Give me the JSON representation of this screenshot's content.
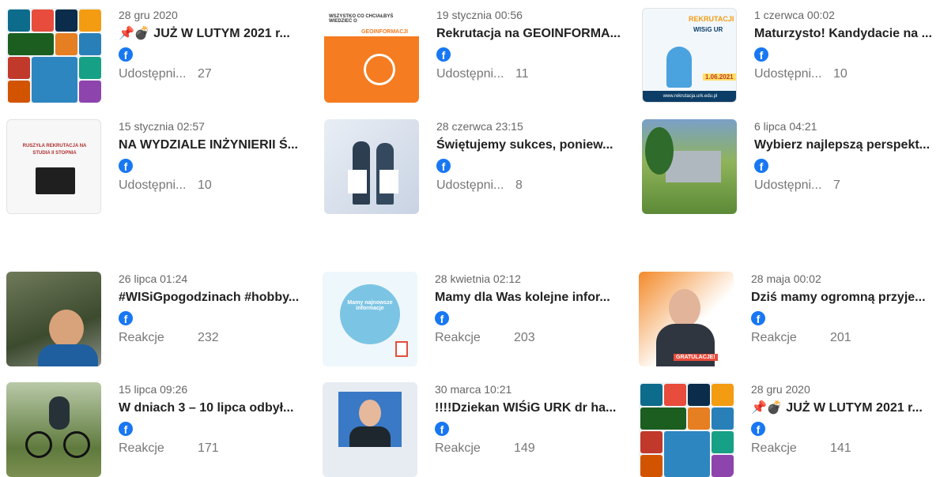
{
  "posts": [
    {
      "date": "28 gru 2020",
      "title": "📌💣 JUŻ W LUTYM 2021 r...",
      "metric_label": "Udostępni...",
      "metric_value": "27"
    },
    {
      "date": "19 stycznia 00:56",
      "title": "Rekrutacja na GEOINFORMA...",
      "metric_label": "Udostępni...",
      "metric_value": "11"
    },
    {
      "date": "1 czerwca 00:02",
      "title": "Maturzysto! Kandydacie na ...",
      "metric_label": "Udostępni...",
      "metric_value": "10"
    },
    {
      "date": "15 stycznia 02:57",
      "title": "NA WYDZIALE INŻYNIERII Ś...",
      "metric_label": "Udostępni...",
      "metric_value": "10"
    },
    {
      "date": "28 czerwca 23:15",
      "title": "Świętujemy sukces, poniew...",
      "metric_label": "Udostępni...",
      "metric_value": "8"
    },
    {
      "date": "6 lipca 04:21",
      "title": "Wybierz najlepszą perspekt...",
      "metric_label": "Udostępni...",
      "metric_value": "7"
    },
    {
      "date": "26 lipca 01:24",
      "title": "#WISiGpogodzinach #hobby...",
      "metric_label": "Reakcje",
      "metric_value": "232"
    },
    {
      "date": "28 kwietnia 02:12",
      "title": "Mamy dla Was kolejne infor...",
      "metric_label": "Reakcje",
      "metric_value": "203"
    },
    {
      "date": "28 maja 00:02",
      "title": "Dziś mamy ogromną przyje...",
      "metric_label": "Reakcje",
      "metric_value": "201"
    },
    {
      "date": "15 lipca 09:26",
      "title": "W dniach 3 – 10 lipca odbył...",
      "metric_label": "Reakcje",
      "metric_value": "171"
    },
    {
      "date": "30 marca 10:21",
      "title": "!!!!Dziekan WIŚiG URK dr ha...",
      "metric_label": "Reakcje",
      "metric_value": "149"
    },
    {
      "date": "28 gru 2020",
      "title": "📌💣 JUŻ W LUTYM 2021 r...",
      "metric_label": "Reakcje",
      "metric_value": "141"
    }
  ],
  "thumb_texts": {
    "geo_tag": "GEOINFORMACJI",
    "geo_heading": "WSZYSTKO CO CHCIAŁBYŚ WIEDZIEĆ O",
    "rek_tag": "REKRUTACJI",
    "rek_sub": "WISiG UR",
    "rek_url": "www.rekrutacja.urk.edu.pl",
    "rek_date": "1.06.2021",
    "buszyla_line1": "RUSZYŁA REKRUTACJA NA",
    "buszyla_line2": "STUDIA II STOPNIA",
    "bubble_head": "Mamy najnowsze informacje",
    "gratulacje": "GRATULACJE!"
  },
  "icons": {
    "facebook": "f"
  }
}
